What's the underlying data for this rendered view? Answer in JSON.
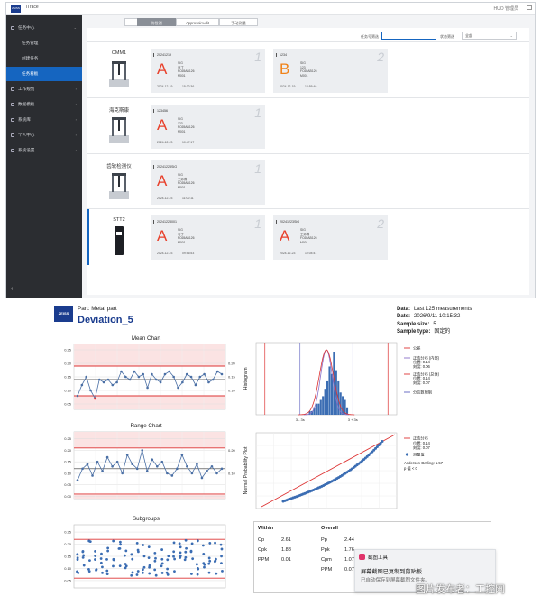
{
  "app": {
    "brand_logo": "ZEISS",
    "title": "iTrace",
    "user": "HUO 管理员",
    "sidebar": [
      {
        "label": "任务中心",
        "icon": "task-icon",
        "chevron": "expanded"
      },
      {
        "label": "任务管理",
        "sub": true
      },
      {
        "label": "创建任务",
        "sub": true
      },
      {
        "label": "任务看板",
        "sub": true,
        "active": true
      },
      {
        "label": "工作规划",
        "icon": "plan-icon",
        "chevron": "collapsed"
      },
      {
        "label": "数据模板",
        "icon": "template-icon",
        "chevron": "collapsed"
      },
      {
        "label": "系统库",
        "icon": "library-icon",
        "chevron": "collapsed"
      },
      {
        "label": "个人中心",
        "icon": "user-icon",
        "chevron": "collapsed"
      },
      {
        "label": "系统设置",
        "icon": "settings-icon",
        "chevron": "collapsed"
      }
    ],
    "tabs": [
      "已提交",
      "待检测",
      "ApprovalAudit",
      "手动测量"
    ],
    "active_tab": "待检测",
    "filter": {
      "label1": "任务号筛选",
      "input_value": "",
      "label2": "状态筛选",
      "select_value": "全部"
    },
    "rows": [
      {
        "machine": "CMM1",
        "cards": [
          {
            "num": "1",
            "id": "20241219",
            "grade": "A",
            "grade_color": "#e8412c",
            "info": [
              "SIG",
              "马丁",
              "FC65AB126",
              "M001"
            ],
            "date": "2024-12-19",
            "time": "15:32:36"
          },
          {
            "num": "2",
            "id": "1234",
            "grade": "B",
            "grade_color": "#f0831a",
            "info": [
              "SIG",
              "123",
              "FC65AB126",
              "M001"
            ],
            "date": "2024-12-19",
            "time": "14:55:40"
          }
        ]
      },
      {
        "machine": "海克斯康",
        "cards": [
          {
            "num": "1",
            "id": "123456",
            "grade": "A",
            "grade_color": "#e8412c",
            "info": [
              "SIG",
              "123",
              "FC65AB126",
              "M001"
            ],
            "date": "2024-12-23",
            "time": "10:47:17"
          }
        ]
      },
      {
        "machine": "齿轮检测仪",
        "cards": [
          {
            "num": "1",
            "id": "20241223SIG",
            "grade": "A",
            "grade_color": "#e8412c",
            "info": [
              "SIG",
              "王师傅",
              "FC65AB126",
              "M001"
            ],
            "date": "2024-12-23",
            "time": "11:00:11"
          }
        ]
      },
      {
        "machine": "STT2",
        "cards": [
          {
            "num": "1",
            "id": "20241223001",
            "grade": "A",
            "grade_color": "#e8412c",
            "info": [
              "SIG",
              "马丁",
              "FC65AB126",
              "M001"
            ],
            "date": "2024-12-23",
            "time": "09:56:53"
          },
          {
            "num": "2",
            "id": "20241223SIG",
            "grade": "A",
            "grade_color": "#e8412c",
            "info": [
              "SIG",
              "王师傅",
              "FC65AB126",
              "M001"
            ],
            "date": "2024-12-23",
            "time": "10:04:41"
          }
        ]
      }
    ]
  },
  "report": {
    "logo_text": "ZEISS",
    "part_label": "Part:  Metal part",
    "title": "Deviation_5",
    "meta": [
      {
        "label": "Data:",
        "value": "Last 125 measurements"
      },
      {
        "label": "Date:",
        "value": "2026/9/11 10:15:32"
      },
      {
        "label": "Sample size:",
        "value": "5"
      },
      {
        "label": "Sample type:",
        "value": "固定的"
      }
    ],
    "mean_chart": {
      "title": "Mean Chart"
    },
    "range_chart": {
      "title": "Range Chart"
    },
    "subgroups": {
      "title": "Subgroups"
    },
    "hist": {
      "ylabel": "Histogram",
      "xticks": [
        "3 - 3s",
        "3 + 3s"
      ]
    },
    "hist_legend": {
      "tolerance": "公差",
      "normal_within": "正态分布 (内部)",
      "normal_within_vals": [
        "位置: 0.14",
        "刻度: 0.06"
      ],
      "normal_overall": "正态分布 (总体)",
      "normal_overall_vals": [
        "位置: 0.14",
        "刻度: 0.07"
      ],
      "quantile": "分位数限制"
    },
    "npp": {
      "ylabel": "Normal Probability Plot"
    },
    "npp_legend": {
      "normal": "正态分布",
      "normal_vals": [
        "位置: 0.14",
        "刻度: 0.07"
      ],
      "points": "测量值",
      "ad": "Anderson-Darling: 1.57",
      "p": "p 值 < 0"
    },
    "capability": {
      "within_header": "Within",
      "overall_header": "Overall",
      "within": [
        [
          "Cp",
          "2.61"
        ],
        [
          "Cpk",
          "1.88"
        ],
        [
          "PPM",
          "0.01"
        ]
      ],
      "overall": [
        [
          "Pp",
          "2.44"
        ],
        [
          "Ppk",
          "1.76"
        ],
        [
          "Cpm",
          "1.07"
        ],
        [
          "PPM",
          "0.07"
        ]
      ]
    },
    "toast": {
      "app": "截图工具",
      "line1": "屏幕截图已复制到剪贴板",
      "line2": "已自动保存到屏幕截图文件夹。"
    },
    "watermark": "图片发布者：工控网"
  },
  "chart_data": [
    {
      "type": "line",
      "title": "Mean Chart",
      "left_ticks": [
        "0.25",
        "0.20",
        "0.15",
        "0.10",
        "0.05"
      ],
      "right_ticks": [
        "0.20",
        "0.15",
        "0.10"
      ],
      "ylim": [
        0.03,
        0.27
      ],
      "limits": {
        "upper": 0.19,
        "center": 0.14,
        "lower": 0.08
      },
      "values": [
        0.08,
        0.12,
        0.15,
        0.1,
        0.07,
        0.14,
        0.13,
        0.14,
        0.12,
        0.13,
        0.17,
        0.15,
        0.14,
        0.17,
        0.15,
        0.16,
        0.11,
        0.16,
        0.14,
        0.13,
        0.16,
        0.17,
        0.15,
        0.11,
        0.13,
        0.16,
        0.15,
        0.12,
        0.15,
        0.16,
        0.13,
        0.14,
        0.17,
        0.16
      ]
    },
    {
      "type": "line",
      "title": "Range Chart",
      "left_ticks": [
        "0.25",
        "0.20",
        "0.15",
        "0.10",
        "0.05",
        "0.00"
      ],
      "right_ticks": [
        "0.20",
        "0.10"
      ],
      "ylim": [
        -0.01,
        0.28
      ],
      "limits": {
        "upper": 0.21,
        "center": 0.12,
        "lower": 0.01
      },
      "values": [
        0.07,
        0.12,
        0.14,
        0.09,
        0.15,
        0.11,
        0.17,
        0.13,
        0.15,
        0.1,
        0.18,
        0.14,
        0.12,
        0.2,
        0.11,
        0.16,
        0.13,
        0.15,
        0.1,
        0.09,
        0.12,
        0.18,
        0.13,
        0.1,
        0.14,
        0.08,
        0.11,
        0.13,
        0.1,
        0.12
      ]
    },
    {
      "type": "scatter",
      "title": "Subgroups",
      "left_ticks": [
        "0.25",
        "0.20",
        "0.15",
        "0.10",
        "0.05"
      ],
      "ylim": [
        0.02,
        0.28
      ],
      "limits": {
        "upper": 0.22,
        "lower": 0.06
      },
      "points_per_group": 5,
      "groups": 25
    },
    {
      "type": "bar",
      "title": "Histogram",
      "ylabel": "Histogram",
      "xlim": [
        -0.02,
        0.3
      ],
      "bin_start": 0.1,
      "bin_width": 0.005,
      "values": [
        1,
        1,
        2,
        3,
        3,
        4,
        5,
        7,
        9,
        13,
        11,
        17,
        12,
        9,
        6,
        5,
        4,
        2
      ]
    },
    {
      "type": "scatter",
      "title": "Normal Probability Plot",
      "ylabel": "Normal Probability Plot",
      "n_points": 60
    }
  ]
}
